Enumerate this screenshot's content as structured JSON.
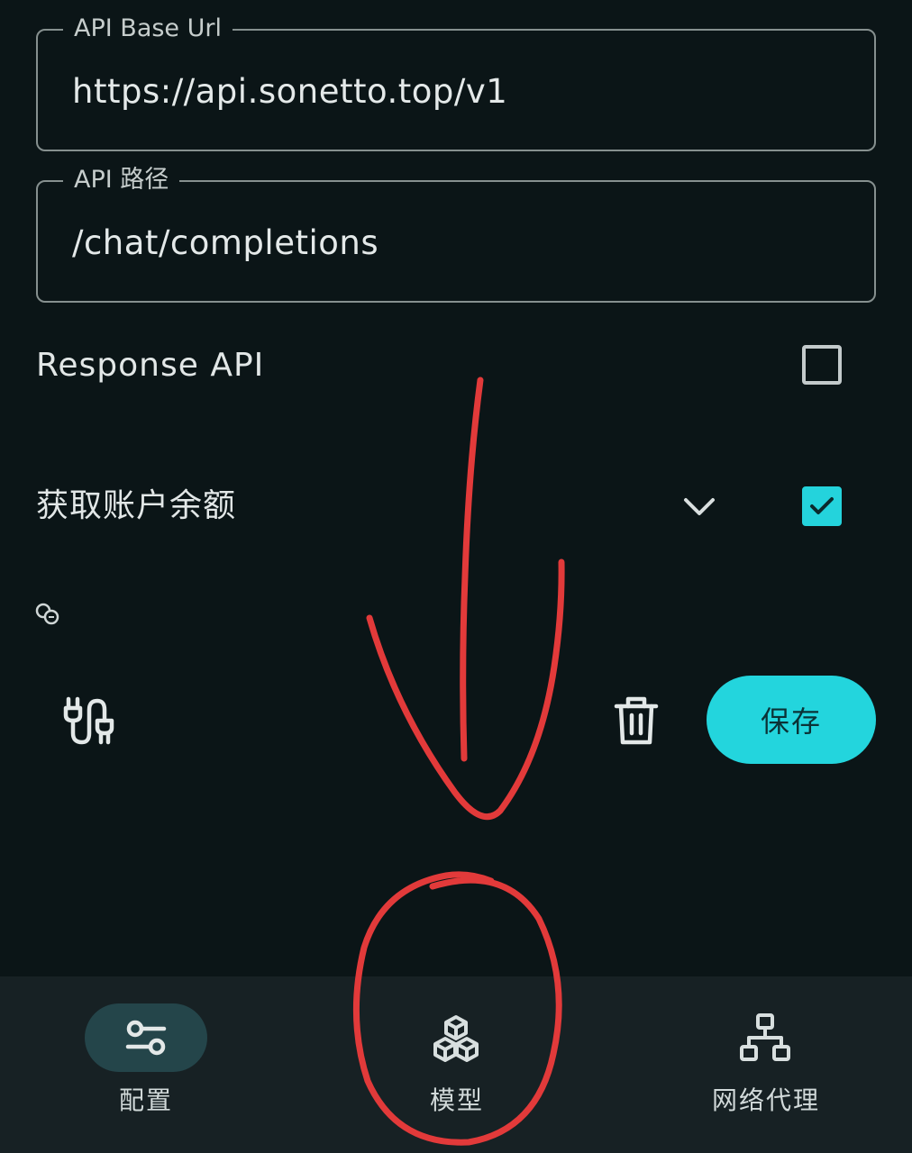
{
  "form": {
    "base_url": {
      "label": "API Base Url",
      "value": "https://api.sonetto.top/v1"
    },
    "api_path": {
      "label": "API 路径",
      "value": "/chat/completions"
    },
    "response_api": {
      "label": "Response API",
      "checked": false
    },
    "fetch_balance": {
      "label": "获取账户余额",
      "checked": true
    }
  },
  "actions": {
    "save_label": "保存"
  },
  "bottom_nav": {
    "items": [
      {
        "label": "配置",
        "icon": "sliders-icon",
        "selected": true
      },
      {
        "label": "模型",
        "icon": "cubes-icon",
        "selected": false
      },
      {
        "label": "网络代理",
        "icon": "network-icon",
        "selected": false
      }
    ]
  },
  "colors": {
    "background": "#0b1517",
    "accent": "#23d5dd",
    "nav_background": "#172124",
    "nav_indicator": "#24454a",
    "annotation": "#e23a3a"
  }
}
